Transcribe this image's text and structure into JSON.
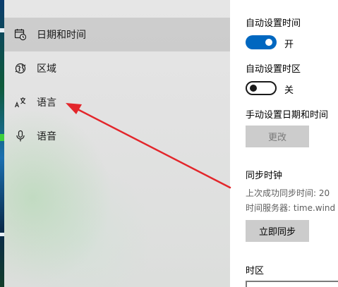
{
  "sidebar": {
    "items": [
      {
        "label": "日期和时间",
        "icon": "calendar-clock-icon",
        "active": true
      },
      {
        "label": "区域",
        "icon": "globe-region-icon",
        "active": false
      },
      {
        "label": "语言",
        "icon": "language-icon",
        "active": false
      },
      {
        "label": "语音",
        "icon": "microphone-icon",
        "active": false
      }
    ]
  },
  "content": {
    "auto_time": {
      "label": "自动设置时间",
      "state": "开",
      "on": true
    },
    "auto_timezone": {
      "label": "自动设置时区",
      "state": "关",
      "on": false
    },
    "manual": {
      "label": "手动设置日期和时间",
      "button": "更改"
    },
    "sync": {
      "title": "同步时钟",
      "last_sync": "上次成功同步时间: 20",
      "server": "时间服务器: time.wind",
      "button": "立即同步"
    },
    "timezone": {
      "label": "时区"
    }
  },
  "colors": {
    "accent": "#0067c0",
    "annotation_arrow": "#e3262b",
    "sidebar_bg": "#e4e4e4"
  }
}
